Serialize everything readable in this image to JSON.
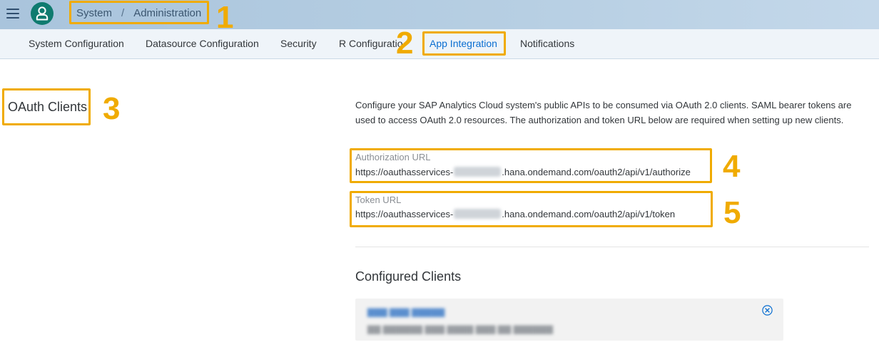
{
  "shell": {
    "menu_icon": "hamburger-menu-icon",
    "avatar_icon": "user-avatar-icon",
    "avatar_color": "#0f7b6f",
    "breadcrumb": [
      "System",
      "Administration"
    ],
    "breadcrumb_separator": "/"
  },
  "tabs": [
    {
      "label": "System Configuration",
      "active": false
    },
    {
      "label": "Datasource Configuration",
      "active": false
    },
    {
      "label": "Security",
      "active": false
    },
    {
      "label": "R Configuratio",
      "active": false
    },
    {
      "label": "App Integration",
      "active": true
    },
    {
      "label": "Notifications",
      "active": false
    }
  ],
  "annotations": [
    "1",
    "2",
    "3",
    "4",
    "5"
  ],
  "annotation_color": "#f0ab00",
  "oauth": {
    "section_title": "OAuth Clients",
    "description": "Configure your SAP Analytics Cloud system's public APIs to be consumed via OAuth 2.0 clients. SAML bearer tokens are used to access OAuth 2.0 resources. The authorization and token URL below are required when setting up new clients.",
    "authorization": {
      "label": "Authorization URL",
      "url_prefix": "https://oauthasservices-",
      "url_suffix": ".hana.ondemand.com/oauth2/api/v1/authorize"
    },
    "token": {
      "label": "Token URL",
      "url_prefix": "https://oauthasservices-",
      "url_suffix": ".hana.ondemand.com/oauth2/api/v1/token"
    }
  },
  "configured_clients": {
    "title": "Configured Clients",
    "remove_icon": "remove-circle-icon"
  }
}
